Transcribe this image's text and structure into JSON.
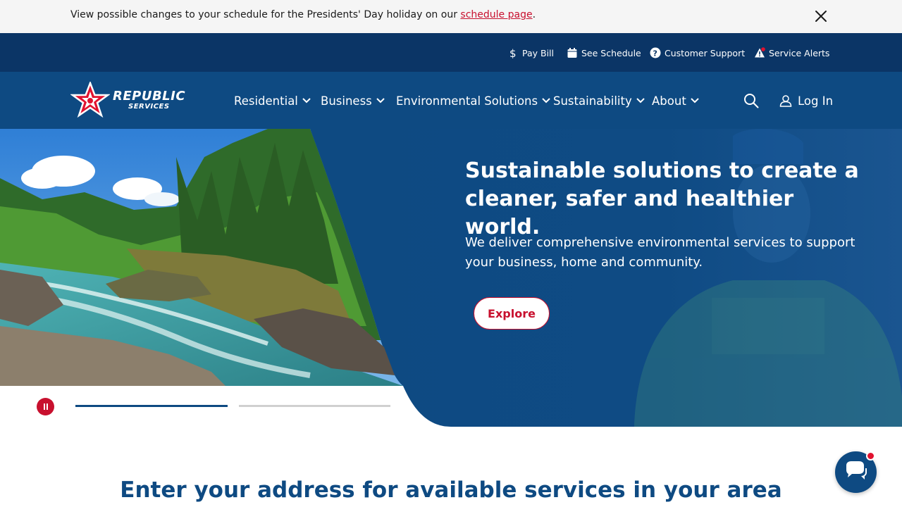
{
  "alert_banner": {
    "text": "View possible changes to your schedule for the Presidents' Day holiday on our ",
    "link": "schedule page",
    "suffix": "."
  },
  "utility_nav": {
    "items": [
      {
        "label": "Pay Bill",
        "icon": "dollar-icon"
      },
      {
        "label": "See Schedule",
        "icon": "calendar-icon"
      },
      {
        "label": "Customer Support",
        "icon": "question-icon"
      },
      {
        "label": "Service Alerts",
        "icon": "warning-icon"
      }
    ]
  },
  "brand": {
    "name_line1": "REPUBLIC",
    "name_line2": "SERVICES"
  },
  "main_nav": {
    "items": [
      {
        "label": "Residential"
      },
      {
        "label": "Business"
      },
      {
        "label": "Environmental Solutions"
      },
      {
        "label": "Sustainability"
      },
      {
        "label": "About"
      }
    ],
    "login_label": "Log In"
  },
  "hero": {
    "title": "Sustainable solutions to create a cleaner, safer and healthier world.",
    "subtitle": "We deliver comprehensive environmental services to support your business, home and community.",
    "cta_label": "Explore"
  },
  "carousel": {
    "slide_count": 2,
    "active_slide": 1
  },
  "address_section": {
    "heading": "Enter your address for available services in your area"
  },
  "colors": {
    "brand_red": "#c8102e",
    "brand_navy": "#0b3566",
    "brand_blue": "#0e4a82"
  }
}
